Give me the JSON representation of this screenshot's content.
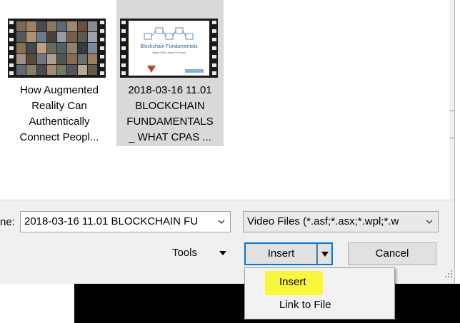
{
  "files": [
    {
      "caption_lines": [
        "How Augmented",
        "Reality Can",
        "Authentically",
        "Connect Peopl..."
      ],
      "selected": false,
      "thumb_kind": "mosaic-video"
    },
    {
      "caption_lines": [
        "2018-03-16 11.01",
        "BLOCKCHAIN",
        "FUNDAMENTALS",
        "_ WHAT CPAS ..."
      ],
      "selected": true,
      "thumb_kind": "slide-video",
      "slide_title": "Blockchain Fundamentals",
      "slide_subtitle": "What CPAs Need to Know"
    }
  ],
  "filename": {
    "label": "ne:",
    "value": "2018-03-16 11.01 BLOCKCHAIN FU"
  },
  "filetype": {
    "value": "Video Files (*.asf;*.asx;*.wpl;*.w"
  },
  "buttons": {
    "tools": "Tools",
    "insert": "Insert",
    "cancel": "Cancel"
  },
  "insert_menu": {
    "items": [
      "Insert",
      "Link to File"
    ],
    "highlight_color": "#f7f73a"
  },
  "colors": {
    "accent": "#0078d7",
    "dialog_bg": "#f0f0f0",
    "selected_tile": "#d9d9d9"
  },
  "icons": {
    "dropdown": "chevron-down-icon",
    "split": "triangle-down-icon",
    "grip": "resize-grip-icon"
  }
}
